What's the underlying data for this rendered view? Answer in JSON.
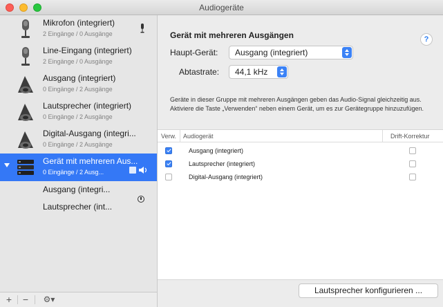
{
  "window": {
    "title": "Audiogeräte"
  },
  "sidebar": {
    "devices": [
      {
        "name": "Mikrofon (integriert)",
        "sub": "2 Eingänge / 0 Ausgänge",
        "icon": "microphone-icon"
      },
      {
        "name": "Line-Eingang (integriert)",
        "sub": "2 Eingänge / 0 Ausgänge",
        "icon": "microphone-icon"
      },
      {
        "name": "Ausgang (integriert)",
        "sub": "0 Eingänge / 2 Ausgänge",
        "icon": "speaker-icon"
      },
      {
        "name": "Lautsprecher (integriert)",
        "sub": "0 Eingänge / 2 Ausgänge",
        "icon": "speaker-icon"
      },
      {
        "name": "Digital-Ausgang (integri...",
        "sub": "0 Eingänge / 2 Ausgänge",
        "icon": "speaker-icon"
      },
      {
        "name": "Gerät mit mehreren Aus...",
        "sub": "0 Eingänge / 2 Ausg...",
        "icon": "multi-output-icon",
        "selected": true
      }
    ],
    "subdevices": [
      "Ausgang (integri...",
      "Lautsprecher (int..."
    ]
  },
  "bottombar": {
    "add": "+",
    "remove": "−",
    "gear": "⚙︎▾"
  },
  "detail": {
    "heading": "Gerät mit mehreren Ausgängen",
    "help": "?",
    "main_device_label": "Haupt-Gerät:",
    "main_device_value": "Ausgang (integriert)",
    "sample_rate_label": "Abtastrate:",
    "sample_rate_value": "44,1 kHz",
    "description": "Geräte in dieser Gruppe mit mehreren Ausgängen geben das Audio-Signal gleichzeitig aus. Aktiviere die Taste „Verwenden“ neben einem Gerät, um es zur Gerätegruppe hinzuzufügen.",
    "table": {
      "columns": {
        "use": "Verw.",
        "device": "Audiogerät",
        "drift": "Drift-Korrektur"
      },
      "rows": [
        {
          "use": true,
          "device": "Ausgang (integriert)",
          "drift": false
        },
        {
          "use": true,
          "device": "Lautsprecher (integriert)",
          "drift": false
        },
        {
          "use": false,
          "device": "Digital-Ausgang (integriert)",
          "drift": false
        }
      ]
    },
    "configure_button": "Lautsprecher konfigurieren ..."
  },
  "colors": {
    "selection": "#3478f6",
    "accent": "#3b82f6",
    "close": "#fc5f57",
    "minimize": "#fdbc2e",
    "maximize": "#28c840"
  }
}
